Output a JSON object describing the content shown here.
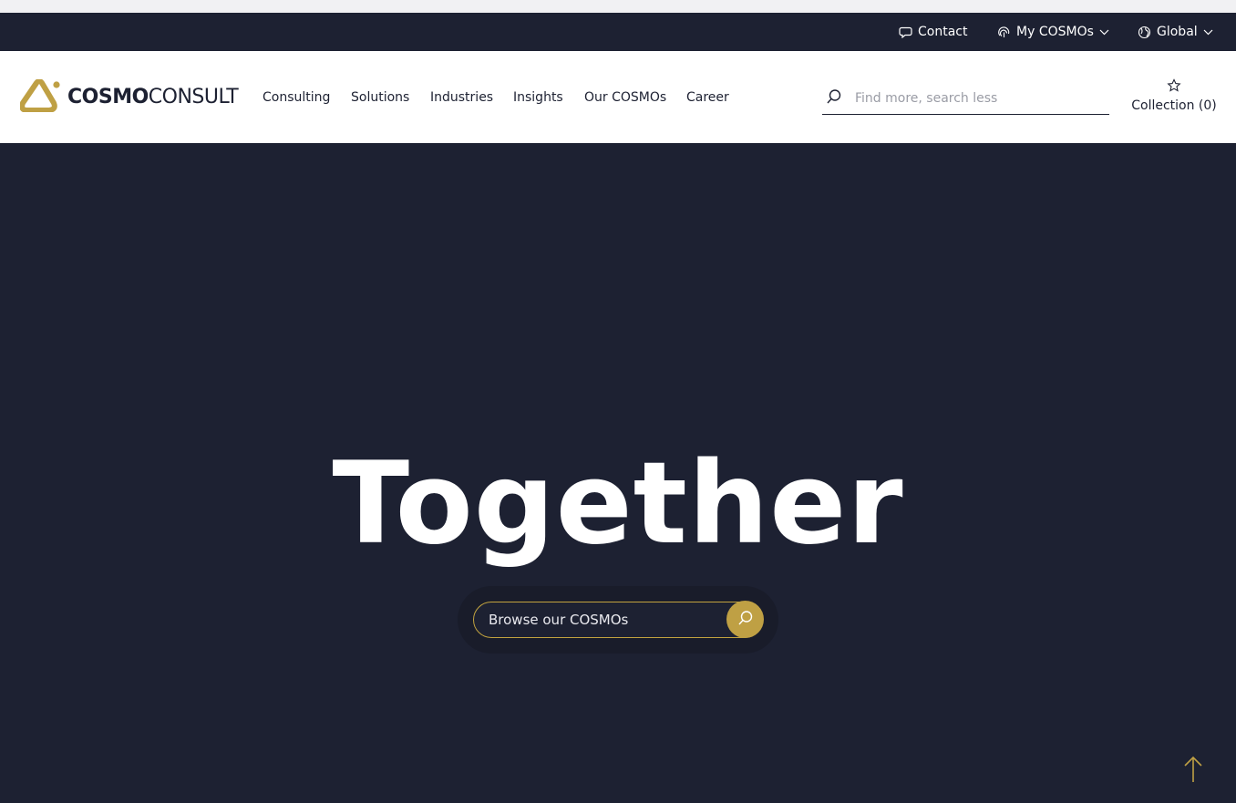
{
  "utility": {
    "contact_label": "Contact",
    "my_cosmos_label": "My COSMOs",
    "global_label": "Global"
  },
  "logo": {
    "bold": "COSMO",
    "light": "CONSULT"
  },
  "nav": {
    "items": [
      "Consulting",
      "Solutions",
      "Industries",
      "Insights",
      "Our COSMOs",
      "Career"
    ]
  },
  "search": {
    "placeholder": "Find more, search less"
  },
  "collection": {
    "label": "Collection (0)"
  },
  "hero": {
    "title": "Together",
    "search_label": "Browse our COSMOs"
  },
  "colors": {
    "navy": "#1d2132",
    "gold": "#bfa044",
    "white": "#ffffff"
  },
  "icons": {
    "contact": "chat-bubble-icon",
    "my_cosmos": "fingerprint-icon",
    "global": "globe-icon",
    "search": "search-icon",
    "collection": "star-icon",
    "scroll_top": "arrow-up-icon"
  }
}
